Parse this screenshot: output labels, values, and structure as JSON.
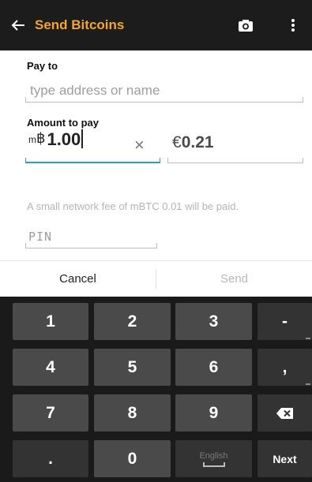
{
  "app_bar": {
    "back_icon": "arrow-back-icon",
    "title": "Send Bitcoins",
    "camera_icon": "camera-icon",
    "menu_icon": "overflow-menu-icon",
    "title_color": "#f4a62a"
  },
  "form": {
    "pay_to_label": "Pay to",
    "pay_to_placeholder": "type address or name",
    "amount_label": "Amount to pay",
    "btc_prefix": "m",
    "btc_symbol": "฿",
    "amount_value": "1.00",
    "clear_symbol": "×",
    "eur_symbol": "€",
    "eur_value": "0.21",
    "fee_text": "A small network fee of mBTC 0.01 will be paid.",
    "pin_placeholder": "PIN"
  },
  "actions": {
    "cancel_label": "Cancel",
    "send_label": "Send"
  },
  "keyboard": {
    "row1": [
      "1",
      "2",
      "3",
      "-"
    ],
    "row2": [
      "4",
      "5",
      "6",
      ","
    ],
    "row3": [
      "7",
      "8",
      "9"
    ],
    "backspace_icon": "backspace-icon",
    "row4_dot": ".",
    "row4_zero": "0",
    "language_label": "English",
    "next_label": "Next"
  },
  "colors": {
    "accent": "#2b9bd1",
    "app_bar_bg": "#1c1c1c",
    "keyboard_bg": "#1a1a1a"
  }
}
